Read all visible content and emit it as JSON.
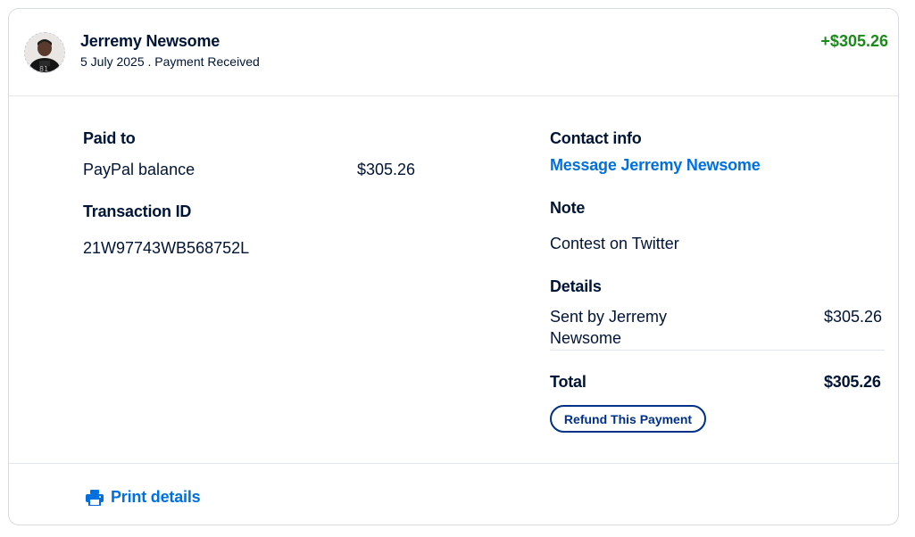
{
  "header": {
    "name": "Jerremy Newsome",
    "subline": "5 July 2025 . Payment Received",
    "amount": "+$305.26",
    "amount_color": "#1a8a1a"
  },
  "paid_to": {
    "label": "Paid to",
    "method": "PayPal balance",
    "amount": "$305.26"
  },
  "transaction": {
    "label": "Transaction ID",
    "id": "21W97743WB568752L"
  },
  "contact": {
    "label": "Contact info",
    "link": "Message Jerremy Newsome"
  },
  "note": {
    "label": "Note",
    "text": "Contest on Twitter"
  },
  "details": {
    "label": "Details",
    "line_label_1": "Sent by Jerremy",
    "line_label_2": "Newsome",
    "line_amount": "$305.26",
    "total_label": "Total",
    "total_amount": "$305.26"
  },
  "actions": {
    "refund_label": "Refund This Payment",
    "print_label": "Print details"
  },
  "icons": {
    "print": "printer-icon",
    "avatar": "user-avatar"
  },
  "colors": {
    "link": "#0070e0",
    "text": "#001435",
    "button_border": "#003087"
  }
}
